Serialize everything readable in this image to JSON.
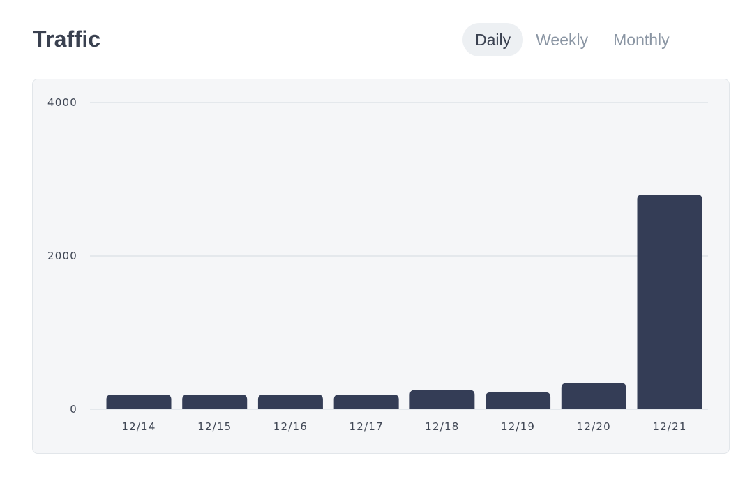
{
  "header": {
    "title": "Traffic"
  },
  "tabs": [
    {
      "label": "Daily",
      "active": true
    },
    {
      "label": "Weekly",
      "active": false
    },
    {
      "label": "Monthly",
      "active": false
    }
  ],
  "colors": {
    "bar": "#343d56",
    "gridline": "#dfe3e8",
    "card_background": "#f5f6f8"
  },
  "chart_data": {
    "type": "bar",
    "title": "",
    "xlabel": "",
    "ylabel": "",
    "categories": [
      "12/14",
      "12/15",
      "12/16",
      "12/17",
      "12/18",
      "12/19",
      "12/20",
      "12/21"
    ],
    "values": [
      190,
      190,
      190,
      190,
      250,
      220,
      340,
      2800
    ],
    "ylim": [
      0,
      4000
    ],
    "yticks": [
      "0",
      "2000",
      "4000"
    ],
    "grid": true,
    "legend": "none"
  }
}
